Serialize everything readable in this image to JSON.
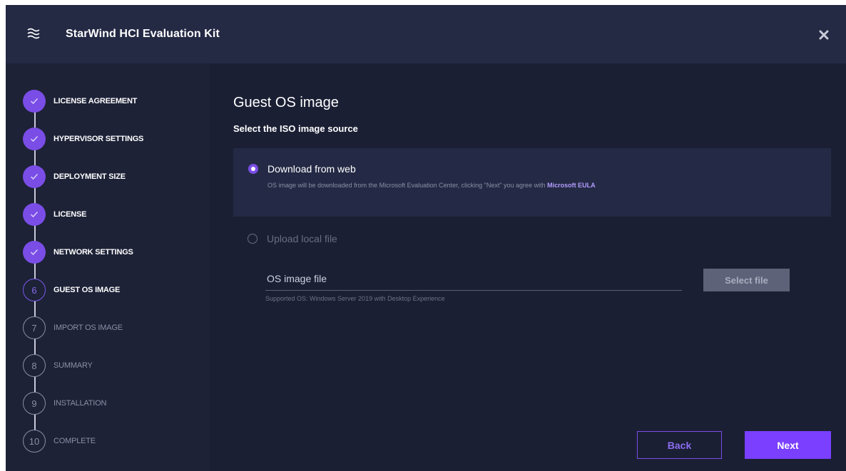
{
  "app": {
    "title": "StarWind HCI Evaluation Kit",
    "logo_icon": "waves-icon",
    "close_icon": "close-icon"
  },
  "colors": {
    "accent": "#7a4de6",
    "window_bg": "#1b1f34",
    "titlebar_bg": "#242944",
    "card_bg": "#242a45"
  },
  "steps": [
    {
      "number": "1",
      "label": "LICENSE AGREEMENT",
      "state": "done"
    },
    {
      "number": "2",
      "label": "HYPERVISOR SETTINGS",
      "state": "done"
    },
    {
      "number": "3",
      "label": "DEPLOYMENT SIZE",
      "state": "done"
    },
    {
      "number": "4",
      "label": "LICENSE",
      "state": "done"
    },
    {
      "number": "5",
      "label": "NETWORK SETTINGS",
      "state": "done"
    },
    {
      "number": "6",
      "label": "GUEST OS IMAGE",
      "state": "current"
    },
    {
      "number": "7",
      "label": "IMPORT OS IMAGE",
      "state": "todo"
    },
    {
      "number": "8",
      "label": "SUMMARY",
      "state": "todo"
    },
    {
      "number": "9",
      "label": "INSTALLATION",
      "state": "todo"
    },
    {
      "number": "10",
      "label": "COMPLETE",
      "state": "todo"
    }
  ],
  "main": {
    "title": "Guest OS image",
    "section_label": "Select the ISO image source",
    "option_web": {
      "label": "Download from web",
      "selected": true,
      "description": "OS image will be downloaded from the Microsoft Evaluation Center, clicking \"Next\" you agree with ",
      "link": "Microsoft EULA"
    },
    "option_local": {
      "label": "Upload local file",
      "selected": false
    },
    "file_field": {
      "label": "OS image file",
      "hint": "Supported OS: Windows Server 2019 with Desktop Experience",
      "button": "Select file"
    }
  },
  "footer": {
    "back": "Back",
    "next": "Next"
  }
}
